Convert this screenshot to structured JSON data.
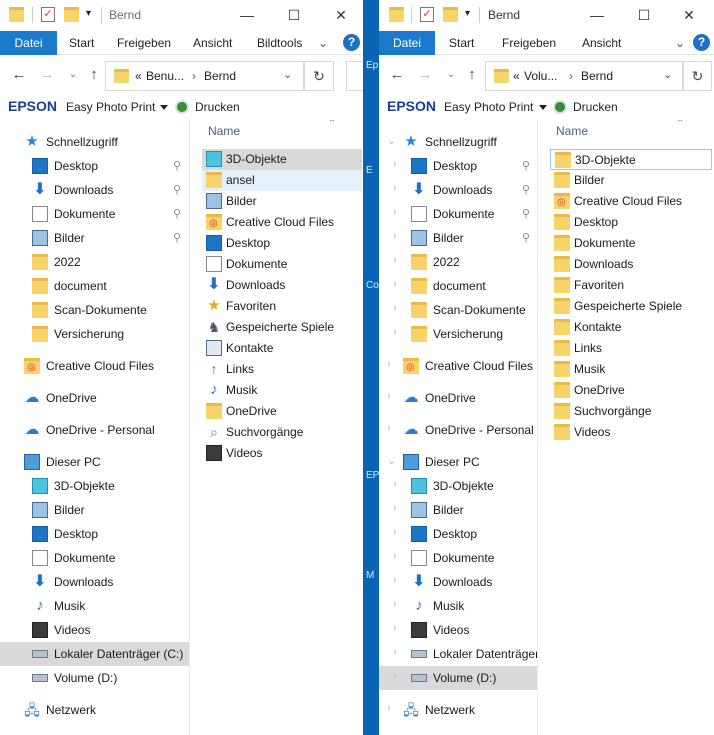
{
  "left": {
    "title": "Bernd",
    "ribbon_tabs": [
      "Datei",
      "Start",
      "Freigeben",
      "Ansicht",
      "Bildtools"
    ],
    "address": {
      "prefix": "«",
      "crumb1": "Benu...",
      "sep": "›",
      "crumb2": "Bernd"
    },
    "nav": [
      {
        "label": "Schnellzugriff",
        "icon": "star-icon"
      },
      {
        "label": "Desktop",
        "icon": "desktop-icon",
        "pinned": true
      },
      {
        "label": "Downloads",
        "icon": "download-icon",
        "pinned": true
      },
      {
        "label": "Dokumente",
        "icon": "document-icon",
        "pinned": true
      },
      {
        "label": "Bilder",
        "icon": "pictures-icon",
        "pinned": true
      },
      {
        "label": "2022",
        "icon": "folder-icon"
      },
      {
        "label": "document",
        "icon": "folder-icon"
      },
      {
        "label": "Scan-Dokumente",
        "icon": "folder-icon"
      },
      {
        "label": "Versicherung",
        "icon": "folder-icon"
      },
      {
        "label": "Creative Cloud Files",
        "icon": "creative-cloud-icon"
      },
      {
        "label": "OneDrive",
        "icon": "cloud-icon"
      },
      {
        "label": "OneDrive - Personal",
        "icon": "cloud-icon"
      },
      {
        "label": "Dieser PC",
        "icon": "pc-icon"
      },
      {
        "label": "3D-Objekte",
        "icon": "3d-objects-icon"
      },
      {
        "label": "Bilder",
        "icon": "pictures-icon"
      },
      {
        "label": "Desktop",
        "icon": "desktop-icon"
      },
      {
        "label": "Dokumente",
        "icon": "document-icon"
      },
      {
        "label": "Downloads",
        "icon": "download-icon"
      },
      {
        "label": "Musik",
        "icon": "music-icon"
      },
      {
        "label": "Videos",
        "icon": "video-icon"
      },
      {
        "label": "Lokaler Datenträger (C:)",
        "icon": "drive-icon",
        "selected": true
      },
      {
        "label": "Volume (D:)",
        "icon": "drive-icon"
      },
      {
        "label": "Netzwerk",
        "icon": "network-icon"
      }
    ],
    "column_header": "Name",
    "files": [
      {
        "label": "3D-Objekte",
        "icon": "3d-objects-icon",
        "selected": true
      },
      {
        "label": "ansel",
        "icon": "folder-icon",
        "hover": true
      },
      {
        "label": "Bilder",
        "icon": "pictures-icon"
      },
      {
        "label": "Creative Cloud Files",
        "icon": "creative-cloud-icon"
      },
      {
        "label": "Desktop",
        "icon": "desktop-icon"
      },
      {
        "label": "Dokumente",
        "icon": "document-icon"
      },
      {
        "label": "Downloads",
        "icon": "download-icon"
      },
      {
        "label": "Favoriten",
        "icon": "favorites-icon"
      },
      {
        "label": "Gespeicherte Spiele",
        "icon": "saved-games-icon"
      },
      {
        "label": "Kontakte",
        "icon": "contacts-icon"
      },
      {
        "label": "Links",
        "icon": "links-icon"
      },
      {
        "label": "Musik",
        "icon": "music-icon"
      },
      {
        "label": "OneDrive",
        "icon": "folder-icon"
      },
      {
        "label": "Suchvorgänge",
        "icon": "search-icon"
      },
      {
        "label": "Videos",
        "icon": "video-icon"
      }
    ]
  },
  "right": {
    "title": "Bernd",
    "ribbon_tabs": [
      "Datei",
      "Start",
      "Freigeben",
      "Ansicht"
    ],
    "address": {
      "prefix": "«",
      "crumb1": "Volu...",
      "sep": "›",
      "crumb2": "Bernd"
    },
    "nav": [
      {
        "label": "Schnellzugriff",
        "icon": "star-icon"
      },
      {
        "label": "Desktop",
        "icon": "desktop-icon",
        "pinned": true
      },
      {
        "label": "Downloads",
        "icon": "download-icon",
        "pinned": true
      },
      {
        "label": "Dokumente",
        "icon": "document-icon",
        "pinned": true
      },
      {
        "label": "Bilder",
        "icon": "pictures-icon",
        "pinned": true
      },
      {
        "label": "2022",
        "icon": "folder-icon"
      },
      {
        "label": "document",
        "icon": "folder-icon"
      },
      {
        "label": "Scan-Dokumente",
        "icon": "folder-icon"
      },
      {
        "label": "Versicherung",
        "icon": "folder-icon"
      },
      {
        "label": "Creative Cloud Files",
        "icon": "creative-cloud-icon"
      },
      {
        "label": "OneDrive",
        "icon": "cloud-icon"
      },
      {
        "label": "OneDrive - Personal",
        "icon": "cloud-icon"
      },
      {
        "label": "Dieser PC",
        "icon": "pc-icon"
      },
      {
        "label": "3D-Objekte",
        "icon": "3d-objects-icon"
      },
      {
        "label": "Bilder",
        "icon": "pictures-icon"
      },
      {
        "label": "Desktop",
        "icon": "desktop-icon"
      },
      {
        "label": "Dokumente",
        "icon": "document-icon"
      },
      {
        "label": "Downloads",
        "icon": "download-icon"
      },
      {
        "label": "Musik",
        "icon": "music-icon"
      },
      {
        "label": "Videos",
        "icon": "video-icon"
      },
      {
        "label": "Lokaler Datenträger",
        "icon": "drive-icon"
      },
      {
        "label": "Volume (D:)",
        "icon": "drive-icon",
        "selected": true
      },
      {
        "label": "Netzwerk",
        "icon": "network-icon"
      }
    ],
    "column_header": "Name",
    "files": [
      {
        "label": "3D-Objekte",
        "icon": "folder-icon",
        "focused": true
      },
      {
        "label": "Bilder",
        "icon": "folder-icon"
      },
      {
        "label": "Creative Cloud Files",
        "icon": "creative-cloud-icon"
      },
      {
        "label": "Desktop",
        "icon": "folder-icon"
      },
      {
        "label": "Dokumente",
        "icon": "folder-icon"
      },
      {
        "label": "Downloads",
        "icon": "folder-icon"
      },
      {
        "label": "Favoriten",
        "icon": "folder-icon"
      },
      {
        "label": "Gespeicherte Spiele",
        "icon": "folder-icon"
      },
      {
        "label": "Kontakte",
        "icon": "folder-icon"
      },
      {
        "label": "Links",
        "icon": "folder-icon"
      },
      {
        "label": "Musik",
        "icon": "folder-icon"
      },
      {
        "label": "OneDrive",
        "icon": "folder-icon"
      },
      {
        "label": "Suchvorgänge",
        "icon": "folder-icon"
      },
      {
        "label": "Videos",
        "icon": "folder-icon"
      }
    ]
  },
  "epson_toolbar": {
    "brand": "EPSON",
    "app": "Easy Photo Print",
    "print": "Drucken"
  },
  "colors": {
    "accent": "#1979ca",
    "selection": "#d9d9d9",
    "hover": "#e5f0fb",
    "folder": "#f7d46a",
    "taskbar": "#0a64b4"
  }
}
